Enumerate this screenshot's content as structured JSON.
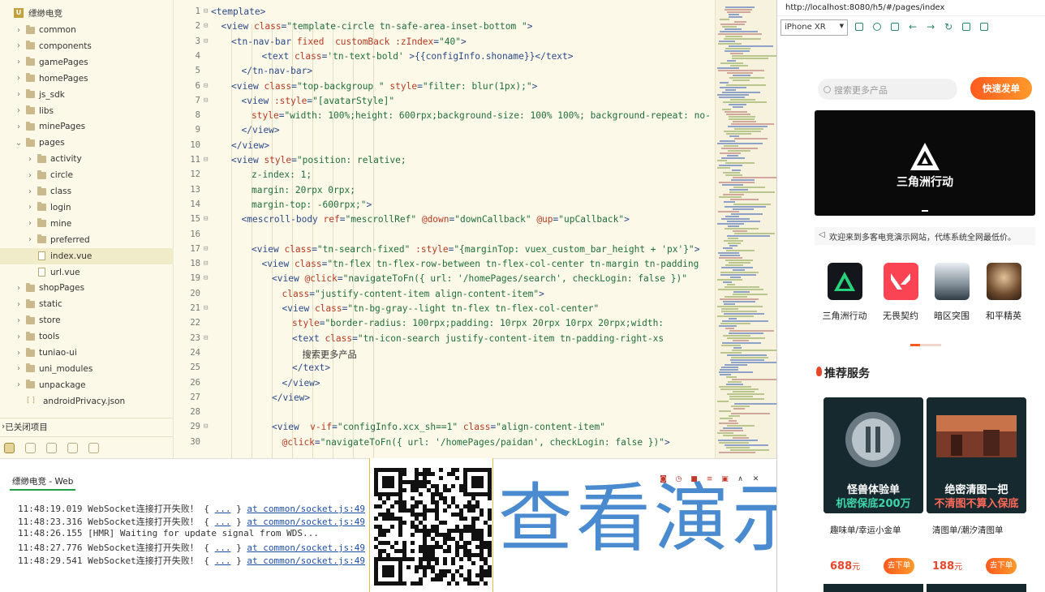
{
  "project": {
    "name": "缥缈电竞",
    "tree": [
      {
        "label": "common",
        "type": "folder",
        "depth": 1
      },
      {
        "label": "components",
        "type": "folder",
        "depth": 1
      },
      {
        "label": "gamePages",
        "type": "folder",
        "depth": 1
      },
      {
        "label": "homePages",
        "type": "folder",
        "depth": 1
      },
      {
        "label": "js_sdk",
        "type": "folder",
        "depth": 1
      },
      {
        "label": "libs",
        "type": "folder",
        "depth": 1
      },
      {
        "label": "minePages",
        "type": "folder",
        "depth": 1
      },
      {
        "label": "pages",
        "type": "folder-open",
        "depth": 1
      },
      {
        "label": "activity",
        "type": "folder",
        "depth": 2
      },
      {
        "label": "circle",
        "type": "folder",
        "depth": 2
      },
      {
        "label": "class",
        "type": "folder",
        "depth": 2
      },
      {
        "label": "login",
        "type": "folder",
        "depth": 2
      },
      {
        "label": "mine",
        "type": "folder",
        "depth": 2
      },
      {
        "label": "preferred",
        "type": "folder",
        "depth": 2
      },
      {
        "label": "index.vue",
        "type": "file",
        "depth": 2,
        "selected": true
      },
      {
        "label": "url.vue",
        "type": "file",
        "depth": 2
      },
      {
        "label": "shopPages",
        "type": "folder",
        "depth": 1
      },
      {
        "label": "static",
        "type": "folder",
        "depth": 1
      },
      {
        "label": "store",
        "type": "folder",
        "depth": 1
      },
      {
        "label": "tools",
        "type": "folder",
        "depth": 1
      },
      {
        "label": "tuniao-ui",
        "type": "folder",
        "depth": 1
      },
      {
        "label": "uni_modules",
        "type": "folder",
        "depth": 1
      },
      {
        "label": "unpackage",
        "type": "folder",
        "depth": 1
      },
      {
        "label": "androidPrivacy.json",
        "type": "json",
        "depth": 1
      }
    ],
    "closed_label": "已关闭项目"
  },
  "editor": {
    "lines": [
      {
        "n": "1",
        "fold": "⊟",
        "indent": 0,
        "html": "<span style='color:#2a4a8a'>&lt;template&gt;</span>"
      },
      {
        "n": "2",
        "fold": "⊟",
        "indent": 2,
        "html": "<span style='color:#2a4a8a'>&lt;view</span> <span style='color:#b63a21'>class</span>=<span style='color:#1f6e3d'>\"template-circle tn-safe-area-inset-bottom \"</span><span style='color:#2a4a8a'>&gt;</span>"
      },
      {
        "n": "3",
        "fold": "⊟",
        "indent": 4,
        "html": "<span style='color:#2a4a8a'>&lt;tn-nav-bar</span> <span style='color:#b63a21'>fixed</span>  <span style='color:#b63a21'>customBack</span> <span style='color:#b63a21'>:zIndex</span>=<span style='color:#1f6e3d'>\"40\"</span><span style='color:#2a4a8a'>&gt;</span>"
      },
      {
        "n": "4",
        "fold": "",
        "indent": 10,
        "html": "<span style='color:#2a4a8a'>&lt;text</span> <span style='color:#b63a21'>class</span>=<span style='color:#1f6e3d'>'tn-text-bold'</span> <span style='color:#2a4a8a'>&gt;</span>{{configInfo.shoname}}<span style='color:#2a4a8a'>&lt;/text&gt;</span>"
      },
      {
        "n": "5",
        "fold": "",
        "indent": 6,
        "html": "<span style='color:#2a4a8a'>&lt;/tn-nav-bar&gt;</span>"
      },
      {
        "n": "6",
        "fold": "⊟",
        "indent": 4,
        "html": "<span style='color:#2a4a8a'>&lt;view</span> <span style='color:#b63a21'>class</span>=<span style='color:#1f6e3d'>\"top-backgroup \"</span> <span style='color:#b63a21'>style</span>=<span style='color:#1f6e3d'>\"filter: blur(1px);\"</span><span style='color:#2a4a8a'>&gt;</span>"
      },
      {
        "n": "7",
        "fold": "⊟",
        "indent": 6,
        "html": "<span style='color:#2a4a8a'>&lt;view</span> <span style='color:#b63a21'>:style</span>=<span style='color:#1f6e3d'>\"[avatarStyle]\"</span>"
      },
      {
        "n": "8",
        "fold": "",
        "indent": 8,
        "html": "<span style='color:#b63a21'>style</span>=<span style='color:#1f6e3d'>\"width: 100%;height: 600rpx;background-size: 100% 100%; background-repeat: no-</span>"
      },
      {
        "n": "9",
        "fold": "",
        "indent": 6,
        "html": "<span style='color:#2a4a8a'>&lt;/view&gt;</span>"
      },
      {
        "n": "10",
        "fold": "",
        "indent": 4,
        "html": "<span style='color:#2a4a8a'>&lt;/view&gt;</span>"
      },
      {
        "n": "11",
        "fold": "⊟",
        "indent": 4,
        "html": "<span style='color:#2a4a8a'>&lt;view</span> <span style='color:#b63a21'>style</span>=<span style='color:#1f6e3d'>\"position: relative;</span>"
      },
      {
        "n": "12",
        "fold": "",
        "indent": 8,
        "html": "<span style='color:#1f6e3d'>z-index: 1;</span>"
      },
      {
        "n": "13",
        "fold": "",
        "indent": 8,
        "html": "<span style='color:#1f6e3d'>margin: 20rpx 0rpx;</span>"
      },
      {
        "n": "14",
        "fold": "",
        "indent": 8,
        "html": "<span style='color:#1f6e3d'>margin-top: -600rpx;\"</span><span style='color:#2a4a8a'>&gt;</span>"
      },
      {
        "n": "15",
        "fold": "⊟",
        "indent": 6,
        "html": "<span style='color:#2a4a8a'>&lt;mescroll-body</span> <span style='color:#b63a21'>ref</span>=<span style='color:#1f6e3d'>\"mescrollRef\"</span> <span style='color:#b63a21'>@down</span>=<span style='color:#1f6e3d'>\"downCallback\"</span> <span style='color:#b63a21'>@up</span>=<span style='color:#1f6e3d'>\"upCallback\"</span><span style='color:#2a4a8a'>&gt;</span>"
      },
      {
        "n": "16",
        "fold": "",
        "indent": 0,
        "html": ""
      },
      {
        "n": "17",
        "fold": "⊟",
        "indent": 8,
        "html": "<span style='color:#2a4a8a'>&lt;view</span> <span style='color:#b63a21'>class</span>=<span style='color:#1f6e3d'>\"tn-search-fixed\"</span> <span style='color:#b63a21'>:style</span>=<span style='color:#1f6e3d'>\"{marginTop: vuex_custom_bar_height + 'px'}\"</span><span style='color:#2a4a8a'>&gt;</span>"
      },
      {
        "n": "18",
        "fold": "⊟",
        "indent": 10,
        "html": "<span style='color:#2a4a8a'>&lt;view</span> <span style='color:#b63a21'>class</span>=<span style='color:#1f6e3d'>\"tn-flex tn-flex-row-between tn-flex-col-center tn-margin tn-padding</span>"
      },
      {
        "n": "19",
        "fold": "⊟",
        "indent": 12,
        "html": "<span style='color:#2a4a8a'>&lt;view</span> <span style='color:#b63a21'>@click</span>=<span style='color:#1f6e3d'>\"navigateToFn({ url: '/homePages/search', checkLogin: false })\"</span>"
      },
      {
        "n": "20",
        "fold": "",
        "indent": 14,
        "html": "<span style='color:#b63a21'>class</span>=<span style='color:#1f6e3d'>\"justify-content-item align-content-item\"</span><span style='color:#2a4a8a'>&gt;</span>"
      },
      {
        "n": "21",
        "fold": "⊟",
        "indent": 14,
        "html": "<span style='color:#2a4a8a'>&lt;view</span> <span style='color:#b63a21'>class</span>=<span style='color:#1f6e3d'>\"tn-bg-gray--light tn-flex tn-flex-col-center\"</span>"
      },
      {
        "n": "22",
        "fold": "",
        "indent": 16,
        "html": "<span style='color:#b63a21'>style</span>=<span style='color:#1f6e3d'>\"border-radius: 100rpx;padding: 10rpx 20rpx 10rpx 20rpx;width:</span>"
      },
      {
        "n": "23",
        "fold": "⊟",
        "indent": 16,
        "html": "<span style='color:#2a4a8a'>&lt;text</span> <span style='color:#b63a21'>class</span>=<span style='color:#1f6e3d'>\"tn-icon-search justify-content-item tn-padding-right-xs</span>"
      },
      {
        "n": "24",
        "fold": "",
        "indent": 18,
        "html": "<span style='color:#333'>搜索更多产品</span>"
      },
      {
        "n": "25",
        "fold": "",
        "indent": 16,
        "html": "<span style='color:#2a4a8a'>&lt;/text&gt;</span>"
      },
      {
        "n": "26",
        "fold": "",
        "indent": 14,
        "html": "<span style='color:#2a4a8a'>&lt;/view&gt;</span>"
      },
      {
        "n": "27",
        "fold": "",
        "indent": 12,
        "html": "<span style='color:#2a4a8a'>&lt;/view&gt;</span>"
      },
      {
        "n": "28",
        "fold": "",
        "indent": 0,
        "html": ""
      },
      {
        "n": "29",
        "fold": "⊟",
        "indent": 12,
        "html": "<span style='color:#2a4a8a'>&lt;view</span>  <span style='color:#b63a21'>v-if</span>=<span style='color:#1f6e3d'>\"configInfo.xcx_sh==1\"</span> <span style='color:#b63a21'>class</span>=<span style='color:#1f6e3d'>\"align-content-item\"</span>"
      },
      {
        "n": "30",
        "fold": "",
        "indent": 14,
        "html": "<span style='color:#b63a21'>@click</span>=<span style='color:#1f6e3d'>\"navigateToFn({ url: '/homePages/paidan', checkLogin: false })\"</span><span style='color:#2a4a8a'>&gt;</span>"
      }
    ]
  },
  "console": {
    "tab": "缥缈电竞 - Web",
    "logs": [
      {
        "time": "11:48:19.019",
        "msg": "WebSocket连接打开失败！ { ",
        "link": "...",
        "tail": " } ",
        "src": "at common/socket.js:49"
      },
      {
        "time": "11:48:23.316",
        "msg": "WebSocket连接打开失败！ { ",
        "link": "...",
        "tail": " } ",
        "src": "at common/socket.js:49"
      },
      {
        "time": "11:48:26.155",
        "msg": "[HMR] Waiting for update signal from WDS...",
        "link": "",
        "tail": "",
        "src": ""
      },
      {
        "time": "11:48:27.776",
        "msg": "WebSocket连接打开失败！ { ",
        "link": "...",
        "tail": " } ",
        "src": "at common/socket.js:49"
      },
      {
        "time": "11:48:29.541",
        "msg": "WebSocket连接打开失败！ { ",
        "link": "...",
        "tail": " } ",
        "src": "at common/socket.js:49"
      }
    ]
  },
  "overlay_text": "查看演示",
  "browser": {
    "url": "http://localhost:8080/h5/#/pages/index",
    "device": "iPhone XR"
  },
  "app": {
    "search_placeholder": "搜索更多产品",
    "quick_order": "快速发单",
    "banner_title": "三角洲行动",
    "notice": "欢迎来到多客电竞演示网站，代练系统全网最低价。",
    "games": [
      "三角洲行动",
      "无畏契约",
      "暗区突围",
      "和平精英"
    ],
    "section_title": "推荐服务",
    "cards": [
      {
        "line1": "怪兽体验单",
        "line2": "机密保底200万",
        "title": "趣味单/幸运小金单",
        "price": "688",
        "unit": "元",
        "action": "去下单"
      },
      {
        "line1": "绝密清图一把",
        "line2": "不清图不算入保底",
        "title": "清图单/潮汐清图单",
        "price": "188",
        "unit": "元",
        "action": "去下单"
      }
    ]
  },
  "colors": {
    "accent": "#ff5a1f",
    "editor_bg": "#fdf9e8",
    "overlay_blue": "#4a8bd0",
    "console_tab": "#22a144"
  }
}
